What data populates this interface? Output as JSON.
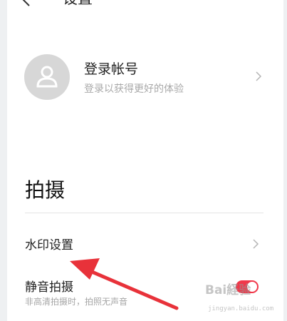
{
  "header": {
    "title": "设置"
  },
  "account": {
    "title": "登录帐号",
    "subtitle": "登录以获得更好的体验"
  },
  "section": {
    "title": "拍摄"
  },
  "rows": {
    "watermark": {
      "label": "水印设置"
    },
    "mute": {
      "label": "静音拍摄",
      "subtitle": "非高清拍摄时，拍照无声音",
      "enabled": true
    }
  },
  "overlay": {
    "watermark_text": "Bai経验",
    "watermark_url": "jingyan.baidu.com"
  },
  "colors": {
    "accent": "#f0384a",
    "annotation_arrow": "#e8323a"
  }
}
